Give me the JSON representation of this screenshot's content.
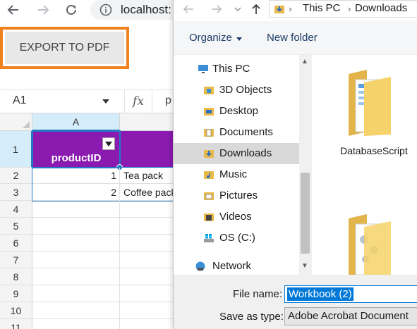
{
  "browser": {
    "url_text": "localhost:"
  },
  "spreadsheet": {
    "export_label": "EXPORT TO PDF",
    "namebox": "A1",
    "fx_label": "fx",
    "formula_value": "p",
    "column_headers": [
      "A"
    ],
    "row_numbers": [
      "1",
      "2",
      "3",
      "4",
      "5",
      "6",
      "7",
      "8",
      "9",
      "10",
      "11"
    ],
    "header_cell": "productID",
    "rows": [
      {
        "id": "1",
        "name": "Tea pack"
      },
      {
        "id": "2",
        "name": "Coffee pack"
      }
    ],
    "colors": {
      "header_fill": "#8a1ab0",
      "selection": "#217ac3",
      "export_border": "#f0821e"
    }
  },
  "dialog": {
    "breadcrumb": [
      "This PC",
      "Downloads"
    ],
    "toolbar": {
      "organize": "Organize",
      "new_folder": "New folder"
    },
    "tree": [
      {
        "label": "This PC",
        "icon": "computer-icon"
      },
      {
        "label": "3D Objects",
        "icon": "3d-objects-folder-icon"
      },
      {
        "label": "Desktop",
        "icon": "desktop-folder-icon"
      },
      {
        "label": "Documents",
        "icon": "documents-folder-icon"
      },
      {
        "label": "Downloads",
        "icon": "downloads-folder-icon",
        "selected": true
      },
      {
        "label": "Music",
        "icon": "music-folder-icon"
      },
      {
        "label": "Pictures",
        "icon": "pictures-folder-icon"
      },
      {
        "label": "Videos",
        "icon": "videos-folder-icon"
      },
      {
        "label": "OS (C:)",
        "icon": "drive-icon"
      },
      {
        "label": "Network",
        "icon": "network-icon"
      }
    ],
    "files": [
      {
        "name": "DatabaseScript"
      }
    ],
    "file_name_label": "File name:",
    "file_name_value": "Workbook (2)",
    "save_type_label": "Save as type:",
    "save_type_value": "Adobe Acrobat Document"
  }
}
